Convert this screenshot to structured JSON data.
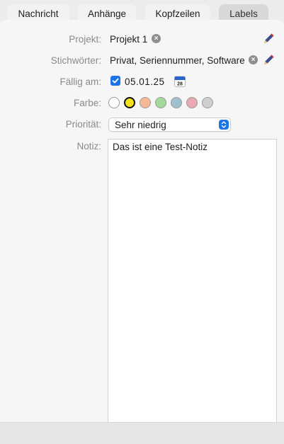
{
  "tabs": [
    {
      "label": "Nachricht"
    },
    {
      "label": "Anhänge"
    },
    {
      "label": "Kopfzeilen"
    },
    {
      "label": "Labels"
    }
  ],
  "form": {
    "project": {
      "label": "Projekt:",
      "value": "Projekt 1"
    },
    "keywords": {
      "label": "Stichwörter:",
      "value": "Privat, Seriennummer, Software"
    },
    "due": {
      "label": "Fällig am:",
      "checked": true,
      "value": "05.01.25",
      "calendar_day": "28"
    },
    "color": {
      "label": "Farbe:",
      "options": [
        "#ffffff",
        "#f5e21c",
        "#f7b896",
        "#a3d99b",
        "#9fc0cf",
        "#e8a9b3",
        "#cfcfcf"
      ],
      "selected_index": 1
    },
    "priority": {
      "label": "Priorität:",
      "value": "Sehr niedrig"
    },
    "note": {
      "label": "Notiz:",
      "value": "Das ist eine Test-Notiz"
    }
  },
  "colors": {
    "accent": "#1a73e8",
    "pencil_red": "#d7322e",
    "pencil_blue": "#3a4e8c"
  }
}
